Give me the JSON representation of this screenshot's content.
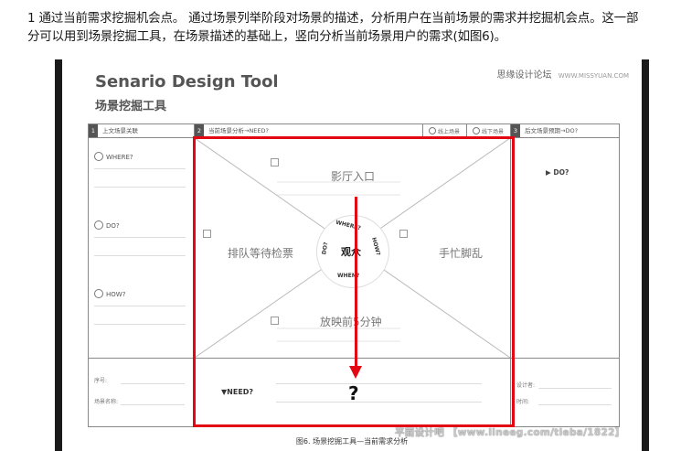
{
  "paragraph": {
    "line1": "1 通过当前需求挖掘机会点。 通过场景列举阶段对场景的描述，分析用户在当前场景的需求并挖掘机会点。这一部",
    "line2": "分可以用到场景挖掘工具，在场景描述的基础上，竖向分析当前场景用户的需求(如图6)。"
  },
  "figure": {
    "title_en": "Senario Design Tool",
    "title_cn": "场景挖掘工具",
    "watermark_top": "思缘设计论坛",
    "watermark_top_url": "WWW.MISSYUAN.COM",
    "columns": [
      {
        "num": "1",
        "label": "上文场景关联"
      },
      {
        "num": "2",
        "label": "当前场景分析→NEED?"
      },
      {
        "num": "3",
        "label": "后文场景预期→DO?"
      }
    ],
    "radio_options": [
      "线上场景",
      "线下场景"
    ],
    "left_labels": [
      "WHERE?",
      "DO?",
      "HOW?"
    ],
    "right_label": "▶ DO?",
    "cells": {
      "top": "影厅入口",
      "left": "排队等待检票",
      "right": "手忙脚乱",
      "bottom": "放映前5分钟"
    },
    "hub": {
      "center": "观众",
      "where": "WHERE?",
      "how": "HOW?",
      "when": "WHEN?",
      "do": "DO?"
    },
    "bottom": {
      "serial": "序号:",
      "scene_name": "场景名称:",
      "need": "▼NEED?",
      "question": "?",
      "designer": "设计者:",
      "time": "时间:"
    },
    "caption": "图6. 场景挖掘工具—当前需求分析",
    "watermark_bottom": "平面设计吧 【www.lineeg.com/tieba/1822】",
    "accent_color": "#e30613"
  }
}
